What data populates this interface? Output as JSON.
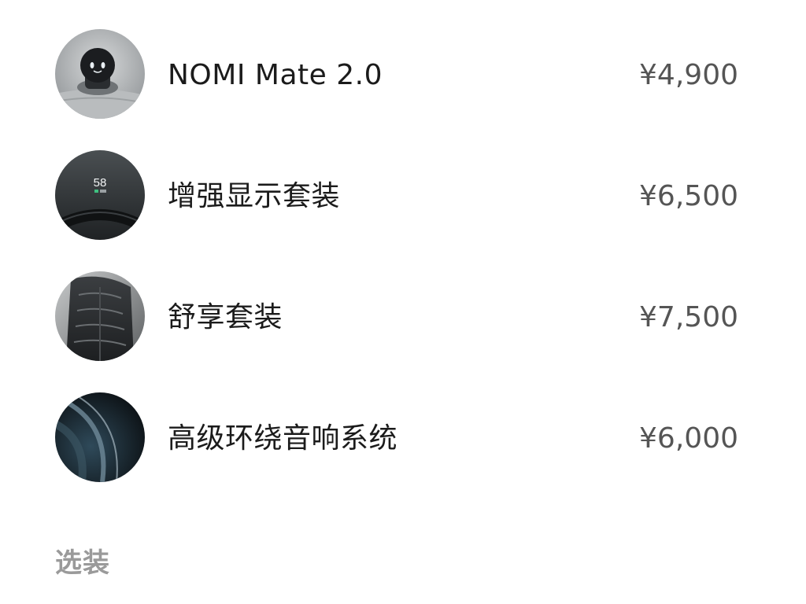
{
  "packages": [
    {
      "name": "NOMI Mate 2.0",
      "price": "¥4,900",
      "thumbnail_text": ""
    },
    {
      "name": "增强显示套装",
      "price": "¥6,500",
      "thumbnail_text": "58"
    },
    {
      "name": "舒享套装",
      "price": "¥7,500",
      "thumbnail_text": ""
    },
    {
      "name": "高级环绕音响系统",
      "price": "¥6,000",
      "thumbnail_text": ""
    }
  ],
  "optional_section": {
    "heading": "选装"
  }
}
